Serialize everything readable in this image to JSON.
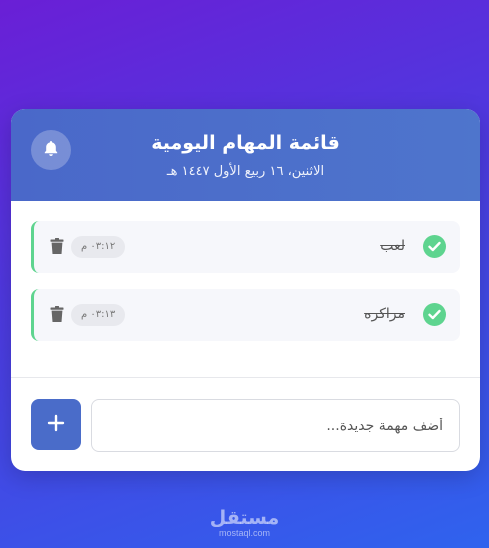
{
  "header": {
    "title": "قائمة المهام اليومية",
    "date": "الاثنين، ١٦ ربيع الأول ١٤٤٧ هـ",
    "bell_icon": "bell-icon"
  },
  "tasks": [
    {
      "text": "لعب",
      "time": "٠٣:١٢ م",
      "done": true
    },
    {
      "text": "مراكره",
      "time": "٠٣:١٣ م",
      "done": true
    }
  ],
  "input": {
    "placeholder": "أضف مهمة جديدة..."
  },
  "add_button": {
    "icon": "plus-icon"
  },
  "watermark": {
    "brand": "مستقل",
    "domain": "mostaql.com"
  },
  "colors": {
    "header": "#4a68c9",
    "done_green": "#5ed48f",
    "add_button": "#4a6cc9"
  }
}
